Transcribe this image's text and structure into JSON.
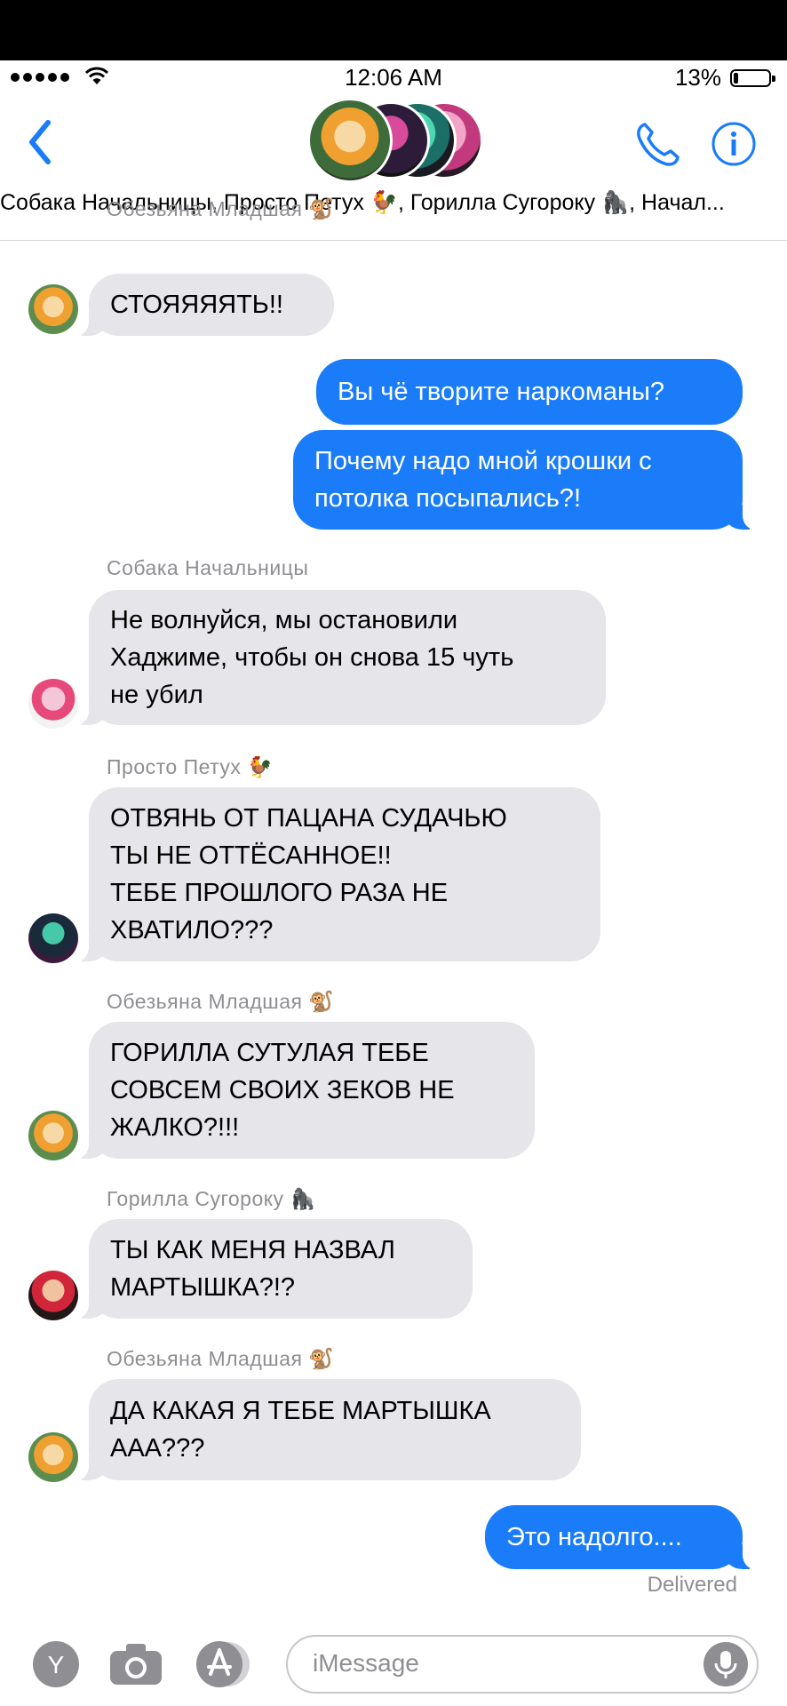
{
  "status_bar": {
    "time": "12:06 AM",
    "battery_percent": "13%",
    "battery_level": 0.13
  },
  "header": {
    "group_names": "Собака Начальницы, Просто Петух 🐓, Горилла Сугороку 🦍, Начал..."
  },
  "messages": [
    {
      "sender": "Обезьяна Младшая 🐒",
      "text": "СТОЯЯЯЯТЬ!!"
    },
    {
      "text": "Вы чё творите наркоманы?"
    },
    {
      "text": "Почему надо мной крошки с\nпотолка посыпались?!"
    },
    {
      "sender": "Собака Начальницы",
      "text": "Не волнуйся, мы остановили\nХаджиме, чтобы он снова 15 чуть\nне убил"
    },
    {
      "sender": "Просто Петух 🐓",
      "text": "ОТВЯНЬ ОТ ПАЦАНА СУДАЧЬЮ\nТЫ НЕ ОТТЁСАННОЕ!!\nТЕБЕ ПРОШЛОГО РАЗА НЕ\nХВАТИЛО???"
    },
    {
      "sender": "Обезьяна Младшая 🐒",
      "text": "ГОРИЛЛА СУТУЛАЯ ТЕБЕ\nСОВСЕМ СВОИХ ЗЕКОВ НЕ\nЖАЛКО?!!!"
    },
    {
      "sender": "Горилла Сугороку 🦍",
      "text": "ТЫ КАК МЕНЯ НАЗВАЛ\nМАРТЫШКА?!?"
    },
    {
      "sender": "Обезьяна Младшая 🐒",
      "text": "ДА КАКАЯ Я ТЕБЕ МАРТЫШКА\nААА???"
    },
    {
      "text": "Это надолго...."
    }
  ],
  "delivered_label": "Delivered",
  "input": {
    "placeholder": "iMessage",
    "app_letter": "Y"
  },
  "colors": {
    "outgoing_bubble": "#1a7cf8",
    "incoming_bubble": "#e5e5ea",
    "accent": "#1a7cf8",
    "secondary_text": "#8e8e93"
  }
}
